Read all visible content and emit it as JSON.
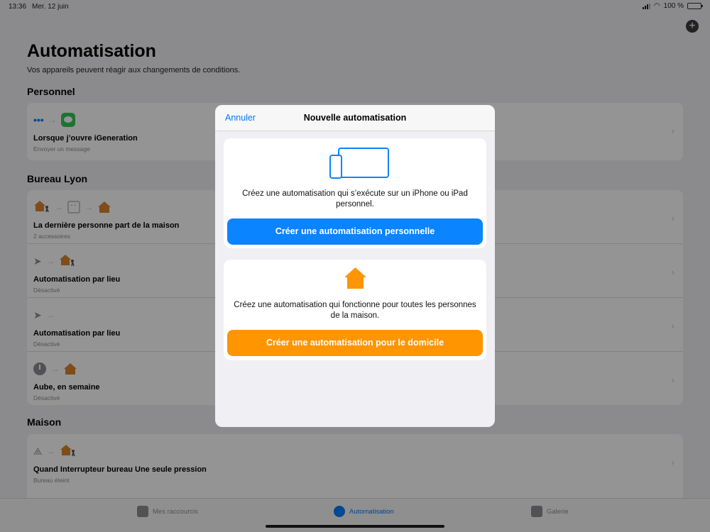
{
  "status": {
    "time": "13:36",
    "date": "Mer. 12 juin",
    "battery": "100 %"
  },
  "page": {
    "title": "Automatisation",
    "subtitle": "Vos appareils peuvent réagir aux changements de conditions."
  },
  "sections": {
    "personnel": {
      "title": "Personnel",
      "rows": [
        {
          "title": "Lorsque j’ouvre iGeneration",
          "sub": "Envoyer un message"
        }
      ]
    },
    "bureau": {
      "title": "Bureau Lyon",
      "rows": [
        {
          "title": "La dernière personne part de la maison",
          "sub": "2 accessoires"
        },
        {
          "title": "Automatisation par lieu",
          "sub": "Désactivé"
        },
        {
          "title": "Automatisation par lieu",
          "sub": "Désactivé"
        },
        {
          "title": "Aube, en semaine",
          "sub": "Désactivé"
        }
      ]
    },
    "maison": {
      "title": "Maison",
      "rows": [
        {
          "title": "Quand Interrupteur bureau Une seule pression",
          "sub": "Bureau éteint"
        }
      ]
    }
  },
  "modal": {
    "cancel": "Annuler",
    "title": "Nouvelle automatisation",
    "personal_desc": "Créez une automatisation qui s’exécute sur un iPhone ou iPad personnel.",
    "personal_button": "Créer une automatisation personnelle",
    "home_desc": "Créez une automatisation qui fonctionne pour toutes les personnes de la maison.",
    "home_button": "Créer une automatisation pour le domicile"
  },
  "tabs": [
    {
      "label": "Mes raccourcis",
      "icon": "grid-icon"
    },
    {
      "label": "Automatisation",
      "icon": "clock-check-icon",
      "active": true
    },
    {
      "label": "Galerie",
      "icon": "layers-icon"
    }
  ],
  "colors": {
    "accent": "#0a84ff",
    "home": "#ff9500",
    "messages": "#34c759"
  }
}
